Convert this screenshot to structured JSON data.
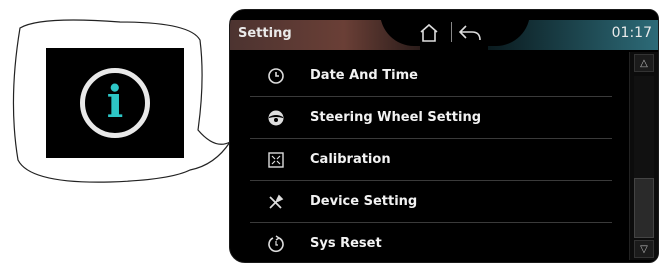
{
  "header": {
    "title": "Setting",
    "clock": "01:17",
    "home_icon": "home-icon",
    "back_icon": "back-arrow-icon"
  },
  "callout": {
    "icon": "info-icon",
    "glyph": "i"
  },
  "menu": {
    "items": [
      {
        "label": "Date And Time",
        "icon": "clock-icon"
      },
      {
        "label": "Steering Wheel Setting",
        "icon": "steering-wheel-icon"
      },
      {
        "label": "Calibration",
        "icon": "calibration-icon"
      },
      {
        "label": "Device Setting",
        "icon": "tools-icon"
      },
      {
        "label": "Sys Reset",
        "icon": "reset-icon"
      }
    ]
  },
  "scrollbar": {
    "up_glyph": "△",
    "down_glyph": "▽"
  },
  "colors": {
    "accent_teal": "#2dc6c6",
    "tab_brown": "#6a3f36",
    "tab_blue": "#2d6b78"
  }
}
